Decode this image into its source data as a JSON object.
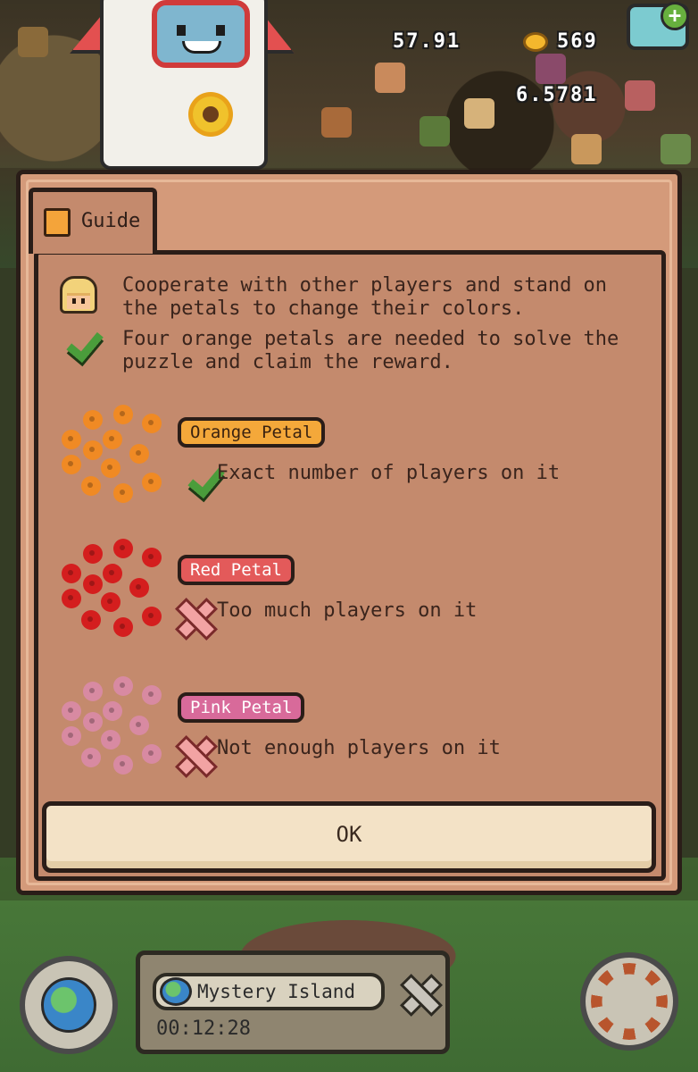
{
  "hud": {
    "stat_left": "57.91",
    "coins": "569",
    "stat_below": "6.5781"
  },
  "modal": {
    "tab_label": "Guide",
    "instructions": [
      {
        "icon": "player-icon",
        "lines": [
          "Cooperate with other players and stand on",
          "the petals to change their colors."
        ]
      },
      {
        "icon": "check-icon",
        "lines": [
          "Four orange petals are needed to solve the",
          "puzzle and claim the reward."
        ]
      }
    ],
    "petals": [
      {
        "name": "Orange Petal",
        "status_icon": "check-icon",
        "description": "Exact number of players on it",
        "color": "#f08a24",
        "badge_bg": "#f4a83a",
        "badge_text": "#3a2210"
      },
      {
        "name": "Red Petal",
        "status_icon": "x-icon",
        "description": "Too much players on it",
        "color": "#d41e1e",
        "badge_bg": "#e35a5a",
        "badge_text": "#ffffff"
      },
      {
        "name": "Pink Petal",
        "status_icon": "x-icon",
        "description": "Not enough players on it",
        "color": "#d88aa2",
        "badge_bg": "#d86a9a",
        "badge_text": "#ffffff"
      }
    ],
    "ok_label": "OK"
  },
  "location": {
    "name": "Mystery Island",
    "timer": "00:12:28"
  },
  "colors": {
    "panel": "#c48a6d",
    "panel_border": "#2a1d18",
    "text": "#3a241c",
    "ok_bg": "#f3e2c6"
  }
}
